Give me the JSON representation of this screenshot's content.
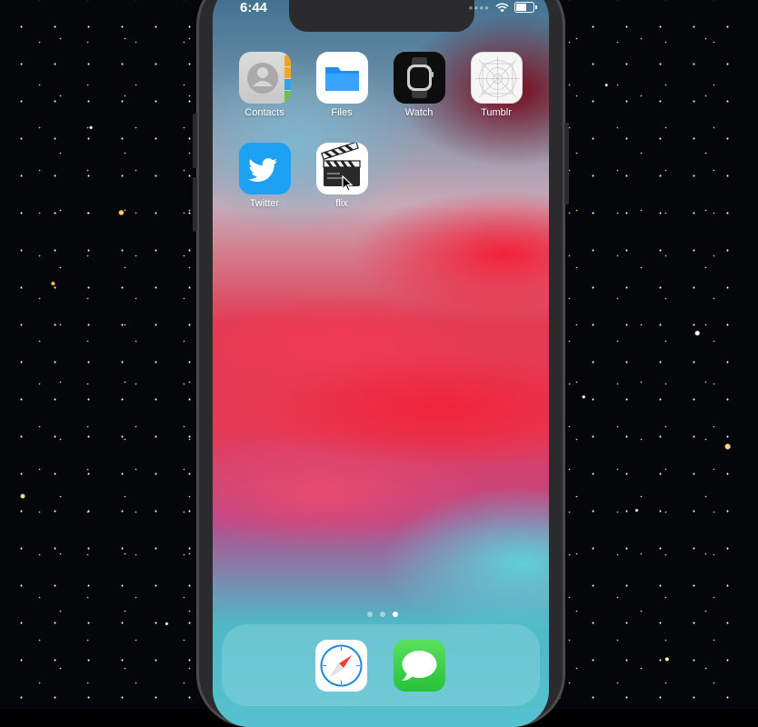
{
  "status_bar": {
    "time": "6:44"
  },
  "home_screen": {
    "apps": [
      {
        "label": "Contacts",
        "icon": "contacts-icon"
      },
      {
        "label": "Files",
        "icon": "files-icon"
      },
      {
        "label": "Watch",
        "icon": "watch-icon"
      },
      {
        "label": "Tumblr",
        "icon": "tumblr-icon"
      },
      {
        "label": "Twitter",
        "icon": "twitter-icon"
      },
      {
        "label": "flix",
        "icon": "clapperboard-icon"
      }
    ],
    "page_count": 3,
    "current_page": 3
  },
  "dock": {
    "apps": [
      {
        "icon": "safari-icon"
      },
      {
        "icon": "messages-icon"
      }
    ]
  },
  "colors": {
    "files_blue": "#1f8df5",
    "twitter_blue": "#1da1f2",
    "messages_green": "#3ccf4a",
    "safari_blue": "#1e88e5"
  }
}
